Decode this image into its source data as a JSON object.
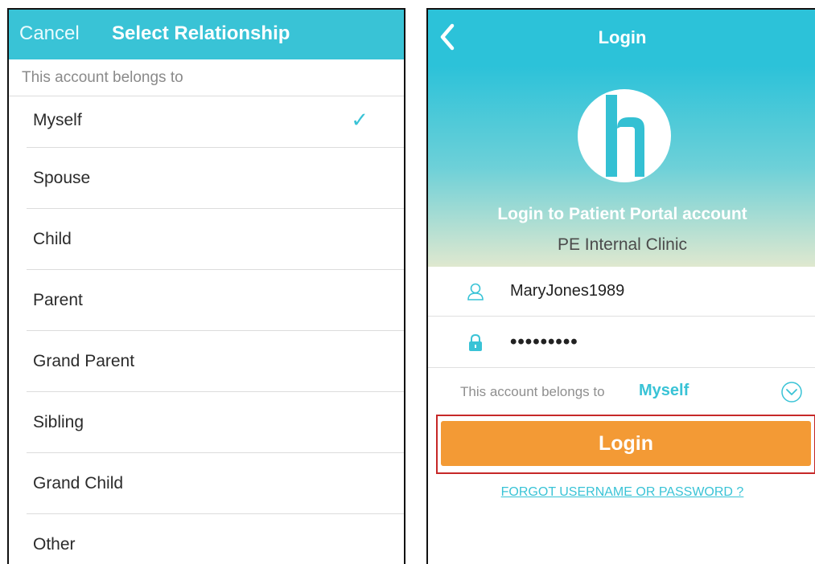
{
  "relationship_screen": {
    "cancel_label": "Cancel",
    "title": "Select Relationship",
    "section_label": "This account belongs to",
    "options": [
      "Myself",
      "Spouse",
      "Child",
      "Parent",
      "Grand Parent",
      "Sibling",
      "Grand Child",
      "Other"
    ],
    "selected_option": "Myself",
    "check_glyph": "✓"
  },
  "login_screen": {
    "title": "Login",
    "hero_title": "Login to Patient Portal account",
    "clinic_name": "PE Internal Clinic",
    "username_value": "MaryJones1989",
    "password_value": "•••••••••",
    "belongs_label": "This account belongs to",
    "belongs_value": "Myself",
    "login_button_label": "Login",
    "forgot_link": "FORGOT USERNAME OR PASSWORD ?"
  },
  "colors": {
    "accent": "#39c3d6",
    "login_button": "#f39a35",
    "highlight_border": "#c62828"
  },
  "icons": [
    "check-icon",
    "back-arrow-icon",
    "clinic-logo",
    "user-icon",
    "lock-icon",
    "chevron-down-circle-icon"
  ]
}
